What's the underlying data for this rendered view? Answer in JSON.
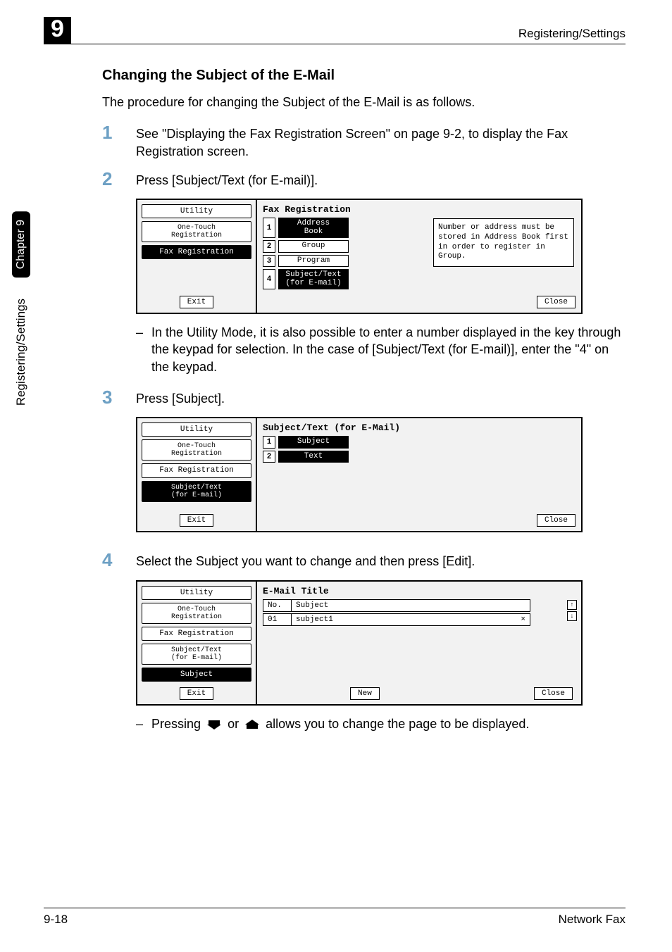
{
  "meta": {
    "chapter_badge": "9",
    "header_right": "Registering/Settings",
    "side_pill": "Chapter 9",
    "side_text": "Registering/Settings",
    "footer_left": "9-18",
    "footer_right": "Network Fax"
  },
  "heading": "Changing the Subject of the E-Mail",
  "intro": "The procedure for changing the Subject of the E-Mail is as follows.",
  "steps": {
    "s1": {
      "num": "1",
      "text": "See \"Displaying the Fax Registration Screen\" on page 9-2, to display the Fax Registration screen."
    },
    "s2": {
      "num": "2",
      "text": "Press [Subject/Text (for E-mail)]."
    },
    "s3": {
      "num": "3",
      "text": "Press [Subject]."
    },
    "s4": {
      "num": "4",
      "text": "Select the Subject you want to change and then press [Edit]."
    }
  },
  "note1": {
    "dash": "–",
    "text": "In the Utility Mode, it is also possible to enter a number displayed in the key through the keypad for selection. In the case of [Subject/Text (for E-mail)], enter the \"4\" on the keypad."
  },
  "note2": {
    "dash": "–",
    "pre": "Pressing ",
    "mid": " or ",
    "post": " allows you to change the page to be displayed."
  },
  "screen1": {
    "left": {
      "utility": "Utility",
      "onetouch": "One-Touch\nRegistration",
      "faxreg": "Fax Registration",
      "exit": "Exit"
    },
    "title": "Fax Registration",
    "rows": [
      {
        "n": "1",
        "label": "Address\nBook"
      },
      {
        "n": "2",
        "label": "Group"
      },
      {
        "n": "3",
        "label": "Program"
      },
      {
        "n": "4",
        "label": "Subject/Text\n(for E-mail)"
      }
    ],
    "info": "Number or address must be stored in Address Book first in order to register in Group.",
    "close": "Close"
  },
  "screen2": {
    "left": {
      "utility": "Utility",
      "onetouch": "One-Touch\nRegistration",
      "faxreg": "Fax Registration",
      "subtxt": "Subject/Text\n(for E-mail)",
      "exit": "Exit"
    },
    "title": "Subject/Text (for E-Mail)",
    "rows": [
      {
        "n": "1",
        "label": "Subject"
      },
      {
        "n": "2",
        "label": "Text"
      }
    ],
    "close": "Close"
  },
  "screen3": {
    "left": {
      "utility": "Utility",
      "onetouch": "One-Touch\nRegistration",
      "faxreg": "Fax Registration",
      "subtxt": "Subject/Text\n(for E-mail)",
      "subject": "Subject",
      "exit": "Exit"
    },
    "title": "E-Mail Title",
    "head_no": "No.",
    "head_sub": "Subject",
    "row_no": "01",
    "row_sub": "subject1",
    "row_mark": "×",
    "scroll_up": "↑",
    "scroll_dn": "↓",
    "new": "New",
    "close": "Close"
  }
}
